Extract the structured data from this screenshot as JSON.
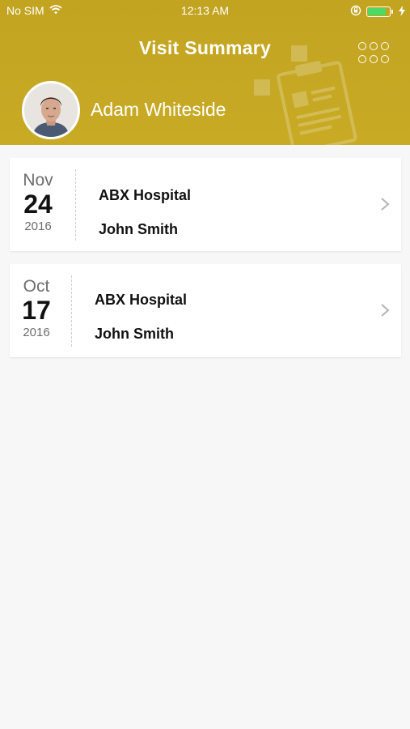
{
  "status_bar": {
    "carrier": "No SIM",
    "time": "12:13 AM",
    "icons": [
      "wifi-icon",
      "orientation-lock-icon",
      "battery-icon",
      "charging-icon"
    ]
  },
  "header": {
    "title": "Visit Summary",
    "menu_icon": "grid-dots-icon",
    "user_name": "Adam Whiteside",
    "background_color": "#c4a623"
  },
  "visits": [
    {
      "month": "Nov",
      "day": "24",
      "year": "2016",
      "hospital": "ABX Hospital",
      "doctor": "John Smith"
    },
    {
      "month": "Oct",
      "day": "17",
      "year": "2016",
      "hospital": "ABX Hospital",
      "doctor": "John Smith"
    }
  ]
}
